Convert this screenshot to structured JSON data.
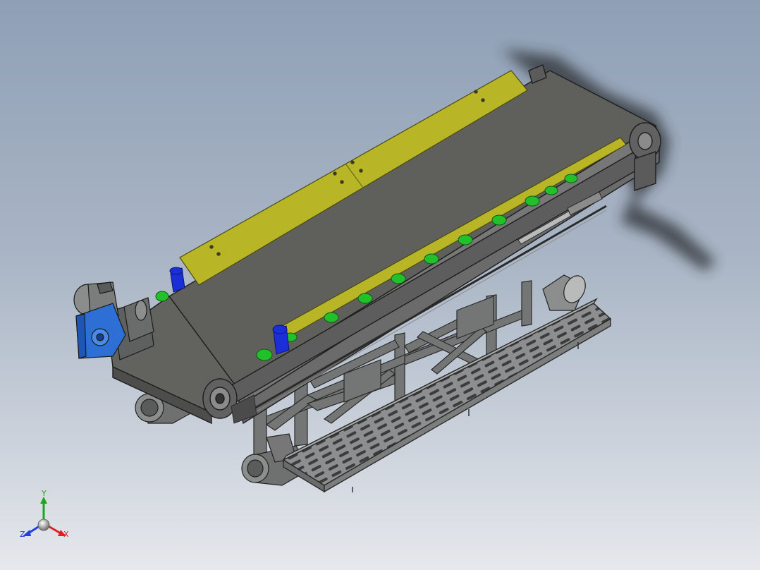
{
  "viewport": {
    "background_top": "#8fa0b6",
    "background_bottom": "#e6e8ec"
  },
  "model": {
    "belt_color": "#5f5f5c",
    "frame_color": "#6e6f6f",
    "skirt_color": "#b8b527",
    "idler_color": "#22c02a",
    "gearbox_color": "#2e6fd6",
    "blue_part_color": "#1b2fd8"
  },
  "triad": {
    "x_label": "X",
    "y_label": "Y",
    "z_label": "Z",
    "x_color": "#e02020",
    "y_color": "#1aa81a",
    "z_color": "#2040e0"
  }
}
